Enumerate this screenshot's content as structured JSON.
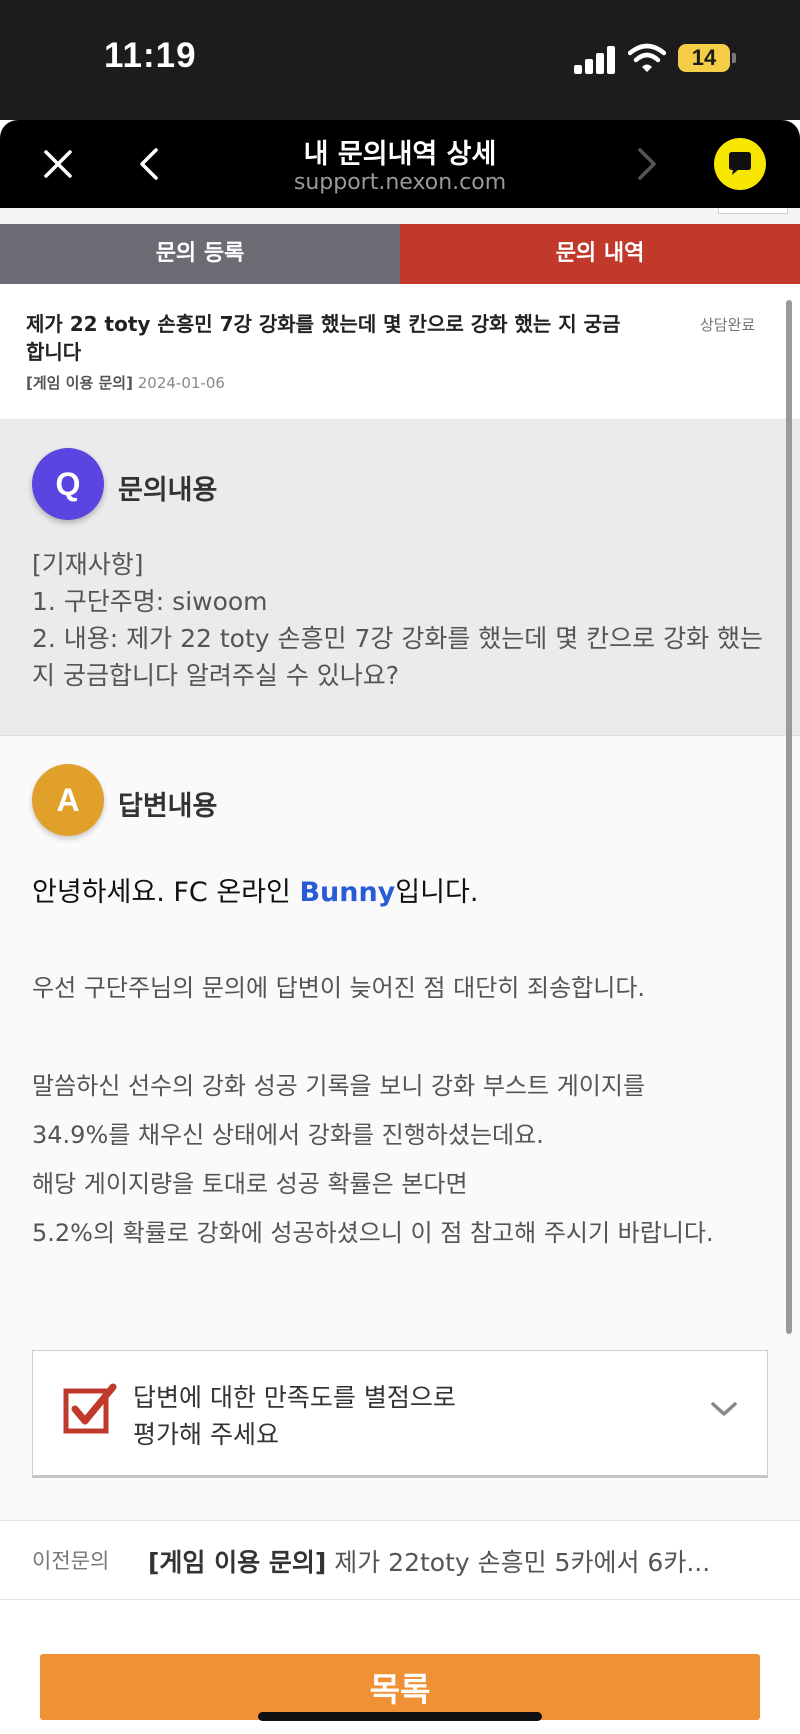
{
  "status_bar": {
    "time": "11:19",
    "battery": "14"
  },
  "browser": {
    "title": "내 문의내역 상세",
    "url": "support.nexon.com"
  },
  "tabs": [
    {
      "label": "문의 등록"
    },
    {
      "label": "문의 내역"
    }
  ],
  "summary": {
    "title": "제가 22 toty 손흥민 7강 강화를 했는데 몇 칸으로 강화 했는 지 궁금합니다",
    "status": "상담완료",
    "category": "[게임 이용 문의]",
    "date": "2024-01-06"
  },
  "question": {
    "badge": "Q",
    "heading": "문의내용",
    "lines": [
      "[기재사항]",
      "1. 구단주명: siwoom",
      "2. 내용: 제가 22 toty 손흥민 7강 강화를 했는데 몇 칸으로 강화 했는 지 궁금합니다 알려주실 수 있나요?"
    ]
  },
  "answer": {
    "badge": "A",
    "heading": "답변내용",
    "greeting_prefix": "안녕하세요. FC 온라인 ",
    "greeting_name": "Bunny",
    "greeting_suffix": "입니다.",
    "paragraphs": [
      [
        "우선 구단주님의 문의에 답변이 늦어진 점 대단히 죄송합니다."
      ],
      [
        "말씀하신 선수의 강화 성공 기록을 보니 강화 부스트 게이지를",
        "34.9%를 채우신 상태에서 강화를 진행하셨는데요."
      ],
      [
        "해당 게이지량을 토대로 성공 확률은 본다면",
        "5.2%의 확률로 강화에 성공하셨으니 이 점 참고해 주시기 바랍니다."
      ]
    ]
  },
  "rating": {
    "line1": "답변에 대한 만족도를 별점으로",
    "line2": "평가해 주세요"
  },
  "previous": {
    "label": "이전문의",
    "category": "[게임 이용 문의]",
    "title": " 제가 22toty 손흥민 5카에서 6카..."
  },
  "list_button": {
    "label": "목록"
  },
  "colors": {
    "tab_active": "#c0392b",
    "tab_inactive": "#6c6c75",
    "q_badge": "#5b45e0",
    "a_badge": "#e0a02a",
    "signature": "#2a5bd7",
    "list_button": "#f09136",
    "chat_button": "#f7e600"
  },
  "icons": [
    "close-icon",
    "back-icon",
    "forward-icon",
    "chat-bubble-icon",
    "checkbox-check-icon",
    "chevron-down-icon",
    "signal-icon",
    "wifi-icon",
    "battery-icon"
  ]
}
